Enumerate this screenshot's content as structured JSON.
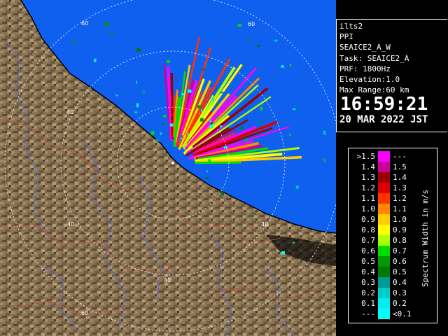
{
  "info": {
    "site": "ilts2",
    "mode": "PPI",
    "scan": "SEAICE2_A_W",
    "task": "Task: SEAICE2_A",
    "prf": "PRF: 1800Hz",
    "elevation": "Elevation:1.0",
    "max_range": "Max Range:60 km",
    "time": "16:59:21",
    "date": "20 MAR 2022 JST"
  },
  "map": {
    "range_ring_labels": [
      {
        "label": "60",
        "ring": "60",
        "where": "upper-left"
      },
      {
        "label": "60",
        "ring": "60",
        "where": "top-right"
      },
      {
        "label": "40",
        "ring": "40",
        "where": "left"
      },
      {
        "label": "40",
        "ring": "40",
        "where": "lower-left"
      },
      {
        "label": "40",
        "ring": "40",
        "where": "right"
      },
      {
        "label": "40",
        "ring": "40",
        "where": "bottom"
      },
      {
        "label": "60",
        "ring": "60",
        "where": "bottom-left"
      }
    ],
    "colors": {
      "sea": "#1060f0",
      "land": "#8c7656",
      "rings": "#ffffff",
      "coast": "#000000",
      "rivers": "#5a6ad8",
      "roads": "#b85040"
    }
  },
  "legend": {
    "unit": "Spectrum Width in m/s",
    "rows": [
      {
        "left": ">1.5",
        "right": "---",
        "color": "#ff00ff"
      },
      {
        "left": "1.4",
        "right": "1.5",
        "color": "#cc0099"
      },
      {
        "left": "1.3",
        "right": "1.4",
        "color": "#990000"
      },
      {
        "left": "1.2",
        "right": "1.3",
        "color": "#dd0000"
      },
      {
        "left": "1.1",
        "right": "1.2",
        "color": "#ff3300"
      },
      {
        "left": "1.0",
        "right": "1.1",
        "color": "#ff8800"
      },
      {
        "left": "0.9",
        "right": "1.0",
        "color": "#ffcc00"
      },
      {
        "left": "0.8",
        "right": "0.9",
        "color": "#ffff00"
      },
      {
        "left": "0.7",
        "right": "0.8",
        "color": "#aaff00"
      },
      {
        "left": "0.6",
        "right": "0.7",
        "color": "#00dd00"
      },
      {
        "left": "0.5",
        "right": "0.6",
        "color": "#009900"
      },
      {
        "left": "0.4",
        "right": "0.5",
        "color": "#007700"
      },
      {
        "left": "0.3",
        "right": "0.4",
        "color": "#009999"
      },
      {
        "left": "0.2",
        "right": "0.3",
        "color": "#00cccc"
      },
      {
        "left": "0.1",
        "right": "0.2",
        "color": "#00eeee"
      },
      {
        "left": "---",
        "right": "<0.1",
        "color": "#00ffff"
      }
    ]
  }
}
